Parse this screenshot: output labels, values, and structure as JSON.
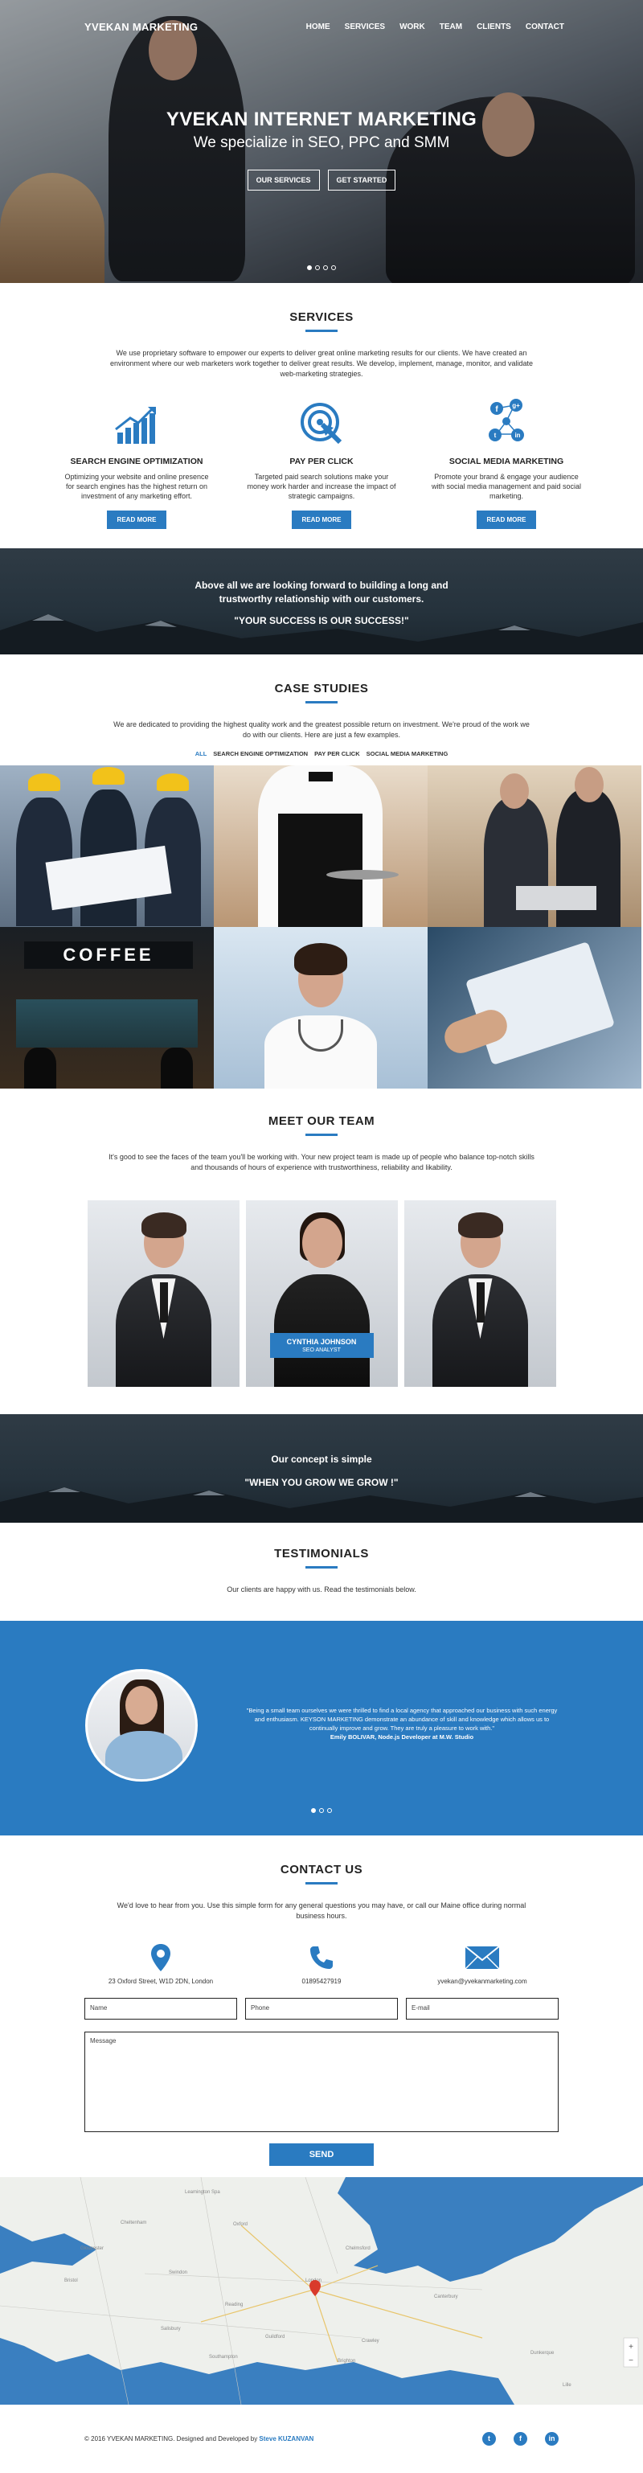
{
  "brand": "YVEKAN MARKETING",
  "nav": [
    "HOME",
    "SERVICES",
    "WORK",
    "TEAM",
    "CLIENTS",
    "CONTACT"
  ],
  "hero": {
    "title": "YVEKAN INTERNET MARKETING",
    "subtitle": "We specialize in SEO, PPC and SMM",
    "btn_services": "OUR SERVICES",
    "btn_started": "GET STARTED"
  },
  "services": {
    "title": "SERVICES",
    "lead": "We use proprietary software to empower our experts to deliver great online marketing results for our clients. We have created an environment where our web marketers work together to deliver great results. We develop, implement, manage, monitor, and validate web-marketing strategies.",
    "items": [
      {
        "title": "SEARCH ENGINE OPTIMIZATION",
        "text": "Optimizing your website and online presence for search engines has the highest return on investment of any marketing effort.",
        "btn": "READ MORE"
      },
      {
        "title": "PAY PER CLICK",
        "text": "Targeted paid search solutions make your money work harder and increase the impact of strategic campaigns.",
        "btn": "READ MORE"
      },
      {
        "title": "SOCIAL MEDIA MARKETING",
        "text": "Promote your brand & engage your audience with social media management and paid social marketing.",
        "btn": "READ MORE"
      }
    ]
  },
  "band1": {
    "line1": "Above all we are looking forward to building a long and",
    "line2": "trustworthy relationship with our customers.",
    "line3": "\"YOUR SUCCESS IS OUR SUCCESS!\""
  },
  "case": {
    "title": "CASE STUDIES",
    "lead": "We are dedicated to providing the highest quality work and the greatest possible return on investment. We're proud of the work we do with our clients. Here are just a few examples.",
    "filters": [
      "ALL",
      "SEARCH ENGINE OPTIMIZATION",
      "PAY PER CLICK",
      "SOCIAL MEDIA MARKETING"
    ],
    "coffee": "COFFEE"
  },
  "team": {
    "title": "MEET OUR TEAM",
    "lead": "It's good to see the faces of the team you'll be working with. Your new project team is made up of people who balance top-notch skills and thousands of hours of experience with trustworthiness, reliability and likability.",
    "member_name": "CYNTHIA JOHNSON",
    "member_role": "SEO ANALYST"
  },
  "band2": {
    "line1": "Our concept is simple",
    "line2": "\"WHEN YOU GROW WE GROW !\""
  },
  "testimonials": {
    "title": "TESTIMONIALS",
    "lead": "Our clients are happy with us. Read the testimonials below.",
    "quote": "\"Being a small team ourselves we were thrilled to find a local agency that approached our business with such energy and enthusiasm. KEYSON MARKETING demonstrate an abundance of skill and knowledge which allows us to continually improve and grow. They are truly a pleasure to work with.\"",
    "author": "Emily BOLIVAR,  Node.js Developer at M.W. Studio"
  },
  "contact": {
    "title": "CONTACT US",
    "lead": "We'd love to hear from you. Use this simple form for any general questions you may have, or call our Maine office during normal business hours.",
    "address": "23 Oxford Street, W1D 2DN, London",
    "phone": "01895427919",
    "email": "yvekan@yvekanmarketing.com",
    "ph_name": "Name",
    "ph_phone": "Phone",
    "ph_email": "E-mail",
    "ph_message": "Message",
    "send": "SEND"
  },
  "footer": {
    "copy": "© 2016 YVEKAN MARKETING. Designed and Developed by ",
    "author": "Steve KUZANVAN"
  },
  "colors": {
    "accent": "#2a7bc1"
  }
}
